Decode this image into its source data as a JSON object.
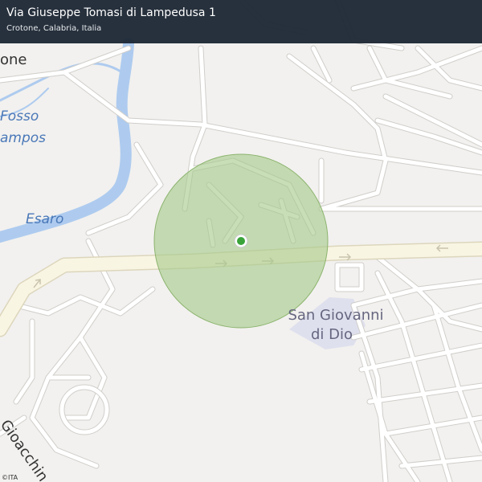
{
  "header": {
    "title": "Via Giuseppe Tomasi di Lampedusa 1",
    "subtitle": "Crotone, Calabria, Italia"
  },
  "map": {
    "labels": {
      "crotone": "one",
      "fosso_line1": "Fosso",
      "fosso_line2": "ampos",
      "esaro": "Esaro",
      "hospital_line1": "San Giovanni",
      "hospital_line2": "di Dio",
      "gioacchino": "Gioacchin"
    },
    "colors": {
      "water": "#aecbef",
      "road": "#ffffff",
      "road_casing": "#d4d2cf",
      "main_road": "#f9f5e3",
      "accuracy_circle": "#a6c98a",
      "marker": "#3aa43a",
      "hospital_area": "#dfe0ee",
      "header_bg": "#1e2935"
    }
  },
  "attribution": "©ITA"
}
